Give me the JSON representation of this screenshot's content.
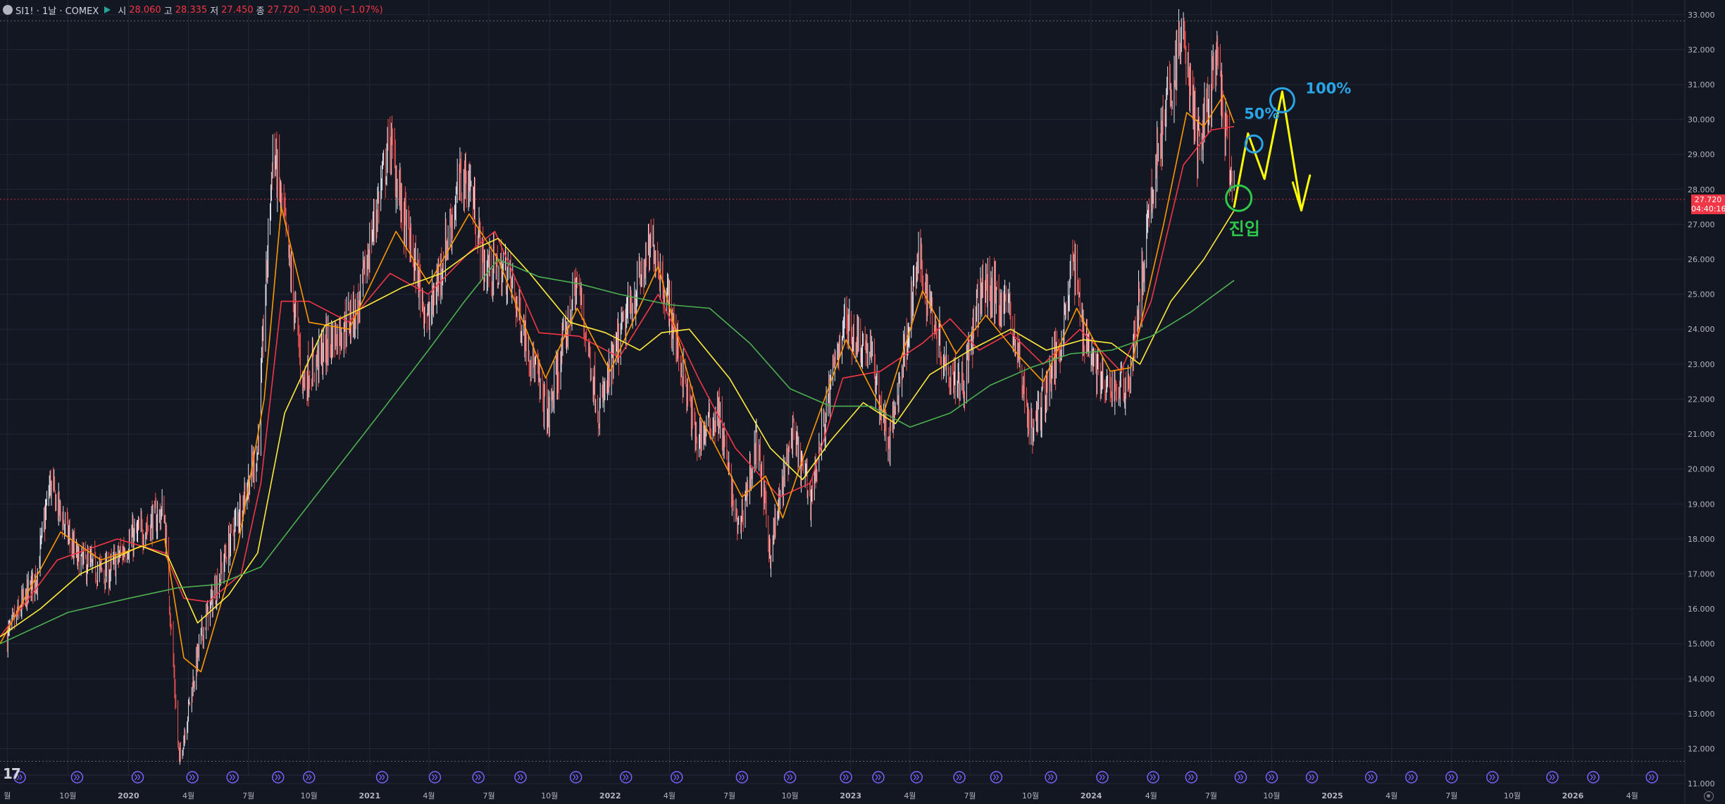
{
  "header": {
    "symbol": "SI1! · 1날 · COMEX",
    "open_label": "시",
    "open": "28.060",
    "high_label": "고",
    "high": "28.335",
    "low_label": "저",
    "low": "27.450",
    "close_label": "종",
    "close": "27.720",
    "change": "−0.300 (−1.07%)"
  },
  "price_tag": {
    "price": "27.720",
    "countdown": "04:40:16"
  },
  "annotations": {
    "entry": "진입",
    "target1": "50%",
    "target2": "100%"
  },
  "colors": {
    "background": "#131722",
    "grid": "#232734",
    "axis_text": "#b2b5be",
    "candle_up": "#26a69a",
    "candle_down": "#ef5350",
    "ma_red": "#f23645",
    "ma_orange": "#ff9800",
    "ma_yellow": "#ffeb3b",
    "ma_green": "#4caf50",
    "projection": "#ffff00",
    "entry_circle": "#2ec94a",
    "target_circle": "#29a5e6"
  },
  "chart_data": {
    "type": "candlestick",
    "title": "SI1! · 1날 · COMEX",
    "y_axis": {
      "ticks": [
        "33.000",
        "32.000",
        "31.000",
        "30.000",
        "29.000",
        "28.000",
        "27.000",
        "26.000",
        "25.000",
        "24.000",
        "23.000",
        "22.000",
        "21.000",
        "20.000",
        "19.000",
        "18.000",
        "17.000",
        "16.000",
        "15.000",
        "14.000",
        "13.000",
        "12.000",
        "11.000"
      ],
      "range": [
        10.6,
        33.6
      ],
      "position": "right"
    },
    "x_axis": {
      "ticks": [
        "월",
        "10월",
        "2020",
        "4월",
        "7월",
        "10월",
        "2021",
        "4월",
        "7월",
        "10월",
        "2022",
        "4월",
        "7월",
        "10월",
        "2023",
        "4월",
        "7월",
        "10월",
        "2024",
        "4월",
        "7월",
        "10월",
        "2025",
        "4월",
        "7월",
        "10월",
        "2026",
        "4월"
      ],
      "range": [
        "2019-06-20",
        "2026-06-20"
      ]
    },
    "last_price": 27.72,
    "price_trajectory": [
      [
        "2019-07-01",
        15.2
      ],
      [
        "2019-08-15",
        17.0
      ],
      [
        "2019-09-04",
        19.6
      ],
      [
        "2019-10-15",
        17.4
      ],
      [
        "2019-12-01",
        17.0
      ],
      [
        "2020-01-01",
        17.9
      ],
      [
        "2020-02-24",
        18.8
      ],
      [
        "2020-03-18",
        11.6
      ],
      [
        "2020-04-20",
        15.2
      ],
      [
        "2020-06-01",
        17.8
      ],
      [
        "2020-07-15",
        20.5
      ],
      [
        "2020-08-07",
        29.2
      ],
      [
        "2020-08-25",
        27.0
      ],
      [
        "2020-09-22",
        22.5
      ],
      [
        "2020-10-30",
        23.6
      ],
      [
        "2020-12-15",
        24.6
      ],
      [
        "2021-01-07",
        27.0
      ],
      [
        "2021-02-01",
        29.4
      ],
      [
        "2021-02-20",
        27.3
      ],
      [
        "2021-03-31",
        24.2
      ],
      [
        "2021-05-18",
        28.2
      ],
      [
        "2021-06-01",
        28.3
      ],
      [
        "2021-06-23",
        25.8
      ],
      [
        "2021-07-30",
        25.6
      ],
      [
        "2021-09-29",
        21.5
      ],
      [
        "2021-11-12",
        25.4
      ],
      [
        "2021-12-15",
        21.6
      ],
      [
        "2022-01-20",
        24.0
      ],
      [
        "2022-03-08",
        26.5
      ],
      [
        "2022-04-01",
        24.6
      ],
      [
        "2022-05-12",
        20.8
      ],
      [
        "2022-06-15",
        21.6
      ],
      [
        "2022-07-14",
        18.2
      ],
      [
        "2022-08-12",
        20.8
      ],
      [
        "2022-09-01",
        17.6
      ],
      [
        "2022-10-04",
        21.0
      ],
      [
        "2022-11-01",
        19.2
      ],
      [
        "2022-12-20",
        24.2
      ],
      [
        "2023-01-30",
        23.4
      ],
      [
        "2023-02-28",
        20.6
      ],
      [
        "2023-04-14",
        26.0
      ],
      [
        "2023-05-25",
        23.0
      ],
      [
        "2023-06-22",
        22.5
      ],
      [
        "2023-07-20",
        25.3
      ],
      [
        "2023-08-30",
        24.6
      ],
      [
        "2023-10-03",
        21.0
      ],
      [
        "2023-11-15",
        23.6
      ],
      [
        "2023-12-04",
        26.0
      ],
      [
        "2023-12-20",
        24.0
      ],
      [
        "2024-01-22",
        22.2
      ],
      [
        "2024-02-28",
        22.5
      ],
      [
        "2024-04-12",
        29.3
      ],
      [
        "2024-05-20",
        32.5
      ],
      [
        "2024-06-10",
        29.2
      ],
      [
        "2024-07-10",
        31.6
      ],
      [
        "2024-08-05",
        27.7
      ]
    ],
    "series": [
      {
        "name": "",
        "color": "#f23645",
        "points": [
          [
            "2019-06-20",
            15.2
          ],
          [
            "2019-09-15",
            17.4
          ],
          [
            "2019-12-15",
            18.0
          ],
          [
            "2020-02-25",
            17.6
          ],
          [
            "2020-03-25",
            16.3
          ],
          [
            "2020-05-01",
            16.2
          ],
          [
            "2020-06-20",
            17.0
          ],
          [
            "2020-07-20",
            19.6
          ],
          [
            "2020-08-20",
            24.8
          ],
          [
            "2020-10-01",
            24.8
          ],
          [
            "2020-12-01",
            24.2
          ],
          [
            "2021-02-01",
            25.6
          ],
          [
            "2021-03-31",
            25.0
          ],
          [
            "2021-06-01",
            26.2
          ],
          [
            "2021-07-10",
            26.8
          ],
          [
            "2021-09-15",
            23.9
          ],
          [
            "2021-11-15",
            23.8
          ],
          [
            "2022-01-15",
            23.2
          ],
          [
            "2022-03-15",
            25.0
          ],
          [
            "2022-05-15",
            22.6
          ],
          [
            "2022-07-10",
            20.6
          ],
          [
            "2022-09-15",
            19.2
          ],
          [
            "2022-11-01",
            19.6
          ],
          [
            "2022-12-20",
            22.6
          ],
          [
            "2023-02-15",
            22.8
          ],
          [
            "2023-04-20",
            23.6
          ],
          [
            "2023-06-01",
            24.3
          ],
          [
            "2023-07-15",
            23.4
          ],
          [
            "2023-09-01",
            23.9
          ],
          [
            "2023-10-20",
            23.0
          ],
          [
            "2023-12-15",
            24.0
          ],
          [
            "2024-02-15",
            22.8
          ],
          [
            "2024-04-01",
            24.8
          ],
          [
            "2024-05-20",
            28.7
          ],
          [
            "2024-07-01",
            29.7
          ],
          [
            "2024-08-05",
            29.8
          ]
        ]
      },
      {
        "name": "",
        "color": "#ff9800",
        "points": [
          [
            "2019-06-20",
            15.0
          ],
          [
            "2019-09-20",
            18.2
          ],
          [
            "2019-11-20",
            17.4
          ],
          [
            "2020-02-25",
            18.0
          ],
          [
            "2020-03-25",
            14.6
          ],
          [
            "2020-04-20",
            14.2
          ],
          [
            "2020-06-15",
            17.8
          ],
          [
            "2020-07-25",
            22.0
          ],
          [
            "2020-08-20",
            27.5
          ],
          [
            "2020-10-01",
            24.2
          ],
          [
            "2020-12-01",
            24.0
          ],
          [
            "2021-02-10",
            26.8
          ],
          [
            "2021-04-01",
            25.3
          ],
          [
            "2021-06-01",
            27.3
          ],
          [
            "2021-07-15",
            26.0
          ],
          [
            "2021-09-25",
            22.6
          ],
          [
            "2021-11-12",
            24.6
          ],
          [
            "2022-01-01",
            22.8
          ],
          [
            "2022-03-15",
            25.8
          ],
          [
            "2022-05-15",
            21.6
          ],
          [
            "2022-07-20",
            19.2
          ],
          [
            "2022-08-25",
            19.8
          ],
          [
            "2022-09-20",
            18.6
          ],
          [
            "2022-10-15",
            20.0
          ],
          [
            "2022-12-25",
            23.7
          ],
          [
            "2023-02-20",
            21.6
          ],
          [
            "2023-04-20",
            25.1
          ],
          [
            "2023-06-10",
            23.3
          ],
          [
            "2023-07-25",
            24.4
          ],
          [
            "2023-09-15",
            23.2
          ],
          [
            "2023-10-20",
            22.5
          ],
          [
            "2023-12-10",
            24.6
          ],
          [
            "2024-01-30",
            22.8
          ],
          [
            "2024-03-01",
            22.9
          ],
          [
            "2024-04-20",
            27.0
          ],
          [
            "2024-05-25",
            30.2
          ],
          [
            "2024-06-20",
            29.8
          ],
          [
            "2024-07-20",
            30.7
          ],
          [
            "2024-08-05",
            29.9
          ]
        ]
      },
      {
        "name": "",
        "color": "#ffeb3b",
        "points": [
          [
            "2019-06-20",
            15.2
          ],
          [
            "2019-08-20",
            16.0
          ],
          [
            "2019-10-20",
            17.0
          ],
          [
            "2020-01-20",
            17.8
          ],
          [
            "2020-03-01",
            17.5
          ],
          [
            "2020-04-15",
            15.6
          ],
          [
            "2020-06-01",
            16.4
          ],
          [
            "2020-07-15",
            17.6
          ],
          [
            "2020-08-25",
            21.6
          ],
          [
            "2020-10-25",
            24.1
          ],
          [
            "2020-12-20",
            24.6
          ],
          [
            "2021-02-20",
            25.2
          ],
          [
            "2021-04-20",
            25.6
          ],
          [
            "2021-06-10",
            26.3
          ],
          [
            "2021-07-15",
            26.6
          ],
          [
            "2021-09-01",
            25.6
          ],
          [
            "2021-11-01",
            24.2
          ],
          [
            "2021-12-25",
            23.9
          ],
          [
            "2022-02-15",
            23.4
          ],
          [
            "2022-03-20",
            23.9
          ],
          [
            "2022-05-01",
            24.0
          ],
          [
            "2022-07-01",
            22.6
          ],
          [
            "2022-09-01",
            20.6
          ],
          [
            "2022-10-20",
            19.7
          ],
          [
            "2022-12-01",
            20.8
          ],
          [
            "2023-01-20",
            21.9
          ],
          [
            "2023-03-10",
            21.3
          ],
          [
            "2023-05-01",
            22.7
          ],
          [
            "2023-07-01",
            23.4
          ],
          [
            "2023-09-01",
            24.0
          ],
          [
            "2023-10-25",
            23.4
          ],
          [
            "2023-12-20",
            23.7
          ],
          [
            "2024-02-01",
            23.6
          ],
          [
            "2024-03-15",
            23.0
          ],
          [
            "2024-05-01",
            24.8
          ],
          [
            "2024-06-20",
            26.0
          ],
          [
            "2024-08-05",
            27.4
          ]
        ]
      },
      {
        "name": "",
        "color": "#4caf50",
        "points": [
          [
            "2019-06-20",
            15.0
          ],
          [
            "2019-10-01",
            15.9
          ],
          [
            "2020-01-01",
            16.3
          ],
          [
            "2020-03-15",
            16.6
          ],
          [
            "2020-05-15",
            16.7
          ],
          [
            "2020-07-20",
            17.2
          ],
          [
            "2020-09-15",
            18.6
          ],
          [
            "2020-11-20",
            20.2
          ],
          [
            "2021-01-25",
            21.8
          ],
          [
            "2021-03-31",
            23.4
          ],
          [
            "2021-05-25",
            24.8
          ],
          [
            "2021-07-15",
            26.0
          ],
          [
            "2021-09-15",
            25.5
          ],
          [
            "2021-11-15",
            25.3
          ],
          [
            "2022-01-15",
            25.0
          ],
          [
            "2022-04-01",
            24.7
          ],
          [
            "2022-06-01",
            24.6
          ],
          [
            "2022-08-01",
            23.6
          ],
          [
            "2022-10-01",
            22.3
          ],
          [
            "2022-12-01",
            21.8
          ],
          [
            "2023-02-01",
            21.8
          ],
          [
            "2023-04-01",
            21.2
          ],
          [
            "2023-06-01",
            21.6
          ],
          [
            "2023-08-01",
            22.4
          ],
          [
            "2023-10-01",
            22.9
          ],
          [
            "2023-12-01",
            23.3
          ],
          [
            "2024-02-01",
            23.4
          ],
          [
            "2024-04-01",
            23.8
          ],
          [
            "2024-06-01",
            24.5
          ],
          [
            "2024-08-05",
            25.4
          ]
        ]
      }
    ],
    "projection": {
      "color": "#ffff00",
      "points": [
        [
          "2024-08-05",
          27.5
        ],
        [
          "2024-08-26",
          29.6
        ],
        [
          "2024-09-20",
          28.3
        ],
        [
          "2024-10-17",
          30.8
        ],
        [
          "2024-11-15",
          27.4
        ]
      ],
      "arrow_wings": [
        [
          "2024-11-02",
          28.2
        ],
        [
          "2024-11-28",
          28.4
        ]
      ]
    },
    "markers": [
      {
        "label": "진입",
        "date": "2024-08-12",
        "value": 27.75,
        "color": "#2ec94a"
      },
      {
        "label": "50%",
        "date": "2024-09-04",
        "value": 29.3,
        "color": "#29a5e6"
      },
      {
        "label": "100%",
        "date": "2024-10-17",
        "value": 30.55,
        "color": "#29a5e6"
      }
    ],
    "dotted_levels": [
      32.82,
      27.72,
      11.64
    ],
    "event_markers_dates": [
      "2019-07-20",
      "2019-10-15",
      "2020-01-15",
      "2020-04-07",
      "2020-06-07",
      "2020-08-15",
      "2020-10-01",
      "2021-01-20",
      "2021-04-10",
      "2021-06-15",
      "2021-08-18",
      "2021-11-10",
      "2022-01-25",
      "2022-04-12",
      "2022-07-20",
      "2022-10-01",
      "2022-12-25",
      "2023-02-12",
      "2023-04-11",
      "2023-06-15",
      "2023-08-10",
      "2023-11-01",
      "2024-01-18",
      "2024-04-04",
      "2024-06-01",
      "2024-08-15",
      "2024-10-01",
      "2024-12-01",
      "2025-03-01",
      "2025-05-01",
      "2025-07-01",
      "2025-09-01",
      "2025-12-01",
      "2026-02-01",
      "2026-05-01"
    ]
  }
}
